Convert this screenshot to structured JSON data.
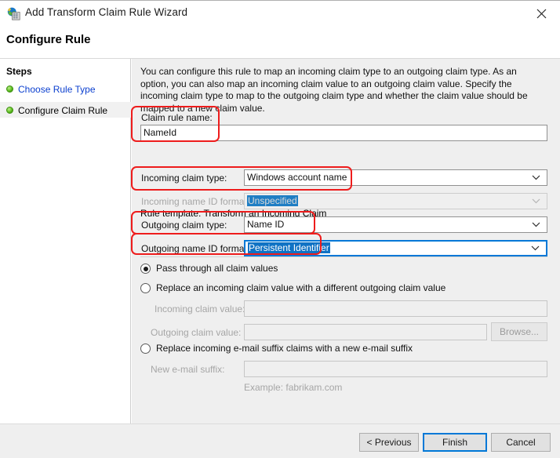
{
  "window": {
    "title": "Add Transform Claim Rule Wizard",
    "icon": "wizard-globe-icon",
    "close_label": "✕"
  },
  "page": {
    "heading": "Configure Rule"
  },
  "steps": {
    "title": "Steps",
    "items": [
      {
        "label": "Choose Rule Type",
        "state": "completed-link"
      },
      {
        "label": "Configure Claim Rule",
        "state": "current"
      }
    ]
  },
  "main": {
    "intro": "You can configure this rule to map an incoming claim type to an outgoing claim type. As an option, you can also map an incoming claim value to an outgoing claim value. Specify the incoming claim type to map to the outgoing claim type and whether the claim value should be mapped to a new claim value.",
    "claim_rule_name": {
      "label": "Claim rule name:",
      "value": "NameId"
    },
    "rule_template": "Rule template: Transform an Incoming Claim",
    "incoming_claim_type": {
      "label": "Incoming claim type:",
      "value": "Windows account name"
    },
    "incoming_name_id_format": {
      "label": "Incoming name ID format:",
      "value": "Unspecified",
      "disabled": true
    },
    "outgoing_claim_type": {
      "label": "Outgoing claim type:",
      "value": "Name ID"
    },
    "outgoing_name_id_format": {
      "label": "Outgoing name ID format:",
      "value": "Persistent Identifier",
      "focused": true
    },
    "options": {
      "pass_through": "Pass through all claim values",
      "replace_value": "Replace an incoming claim value with a different outgoing claim value",
      "replace_suffix": "Replace incoming e-mail suffix claims with a new e-mail suffix"
    },
    "incoming_claim_value": {
      "label": "Incoming claim value:",
      "value": ""
    },
    "outgoing_claim_value": {
      "label": "Outgoing claim value:",
      "value": ""
    },
    "browse_button": "Browse...",
    "new_email_suffix": {
      "label": "New e-mail suffix:",
      "value": ""
    },
    "example_text": "Example: fabrikam.com"
  },
  "footer": {
    "previous": "< Previous",
    "finish": "Finish",
    "cancel": "Cancel"
  },
  "colors": {
    "annotation": "#ee1c1c",
    "accent": "#0078d7",
    "link": "#0b3fcf",
    "selection": "#0f72c4"
  }
}
